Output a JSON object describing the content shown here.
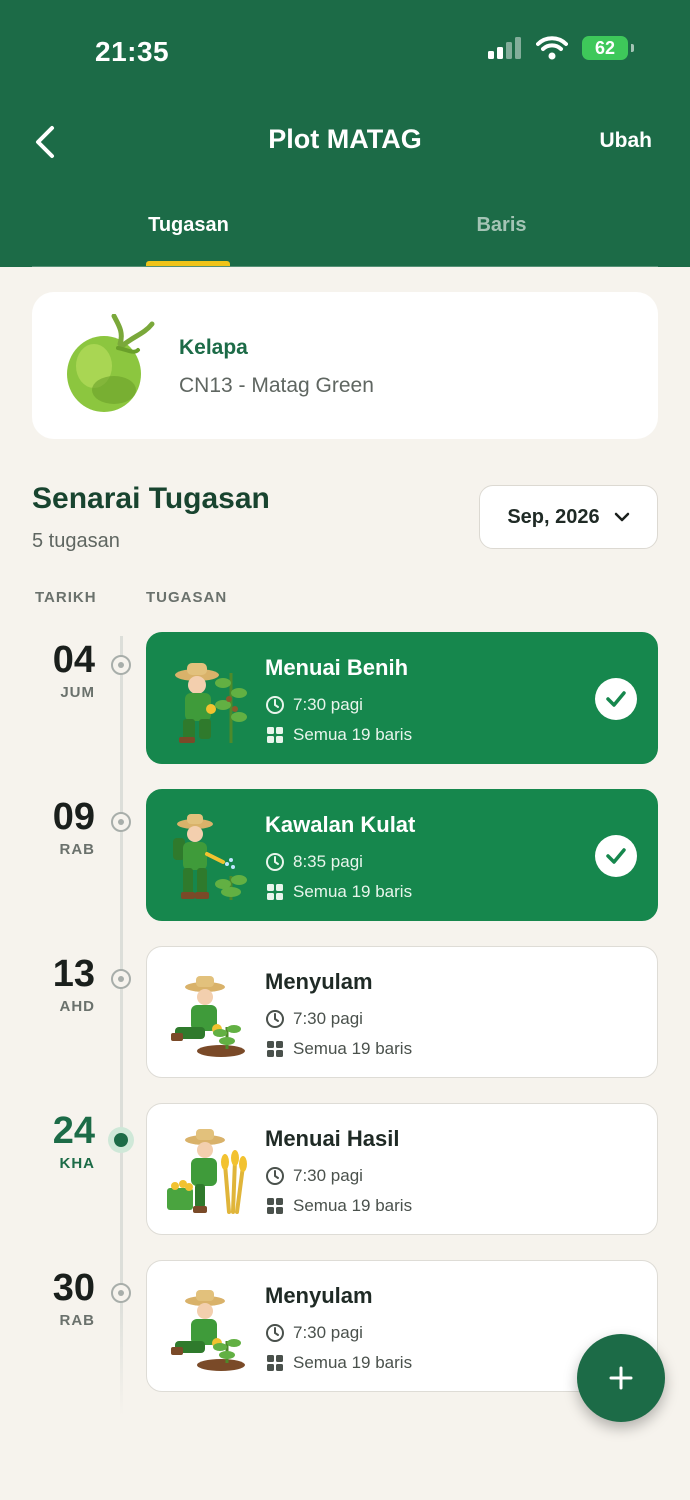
{
  "status": {
    "time": "21:35",
    "battery": "62"
  },
  "header": {
    "title": "Plot MATAG",
    "edit_label": "Ubah"
  },
  "tabs": [
    {
      "label": "Tugasan",
      "active": true
    },
    {
      "label": "Baris",
      "active": false
    }
  ],
  "crop": {
    "name": "Kelapa",
    "variety": "CN13 - Matag Green"
  },
  "list": {
    "title": "Senarai Tugasan",
    "count": "5 tugasan",
    "month": "Sep, 2026",
    "col_date": "TARIKH",
    "col_task": "TUGASAN"
  },
  "tasks": [
    {
      "day": "04",
      "weekday": "JUM",
      "name": "Menuai Benih",
      "time": "7:30 pagi",
      "rows": "Semua 19 baris",
      "done": true,
      "today": false
    },
    {
      "day": "09",
      "weekday": "RAB",
      "name": "Kawalan Kulat",
      "time": "8:35 pagi",
      "rows": "Semua 19 baris",
      "done": true,
      "today": false
    },
    {
      "day": "13",
      "weekday": "AHD",
      "name": "Menyulam",
      "time": "7:30 pagi",
      "rows": "Semua 19 baris",
      "done": false,
      "today": false
    },
    {
      "day": "24",
      "weekday": "KHA",
      "name": "Menuai Hasil",
      "time": "7:30 pagi",
      "rows": "Semua 19 baris",
      "done": false,
      "today": true
    },
    {
      "day": "30",
      "weekday": "RAB",
      "name": "Menyulam",
      "time": "7:30 pagi",
      "rows": "Semua 19 baris",
      "done": false,
      "today": false
    }
  ],
  "colors": {
    "primary": "#1c6b47",
    "done_card": "#16874d",
    "tab_indicator": "#f0c419",
    "background": "#f6f3ed"
  }
}
